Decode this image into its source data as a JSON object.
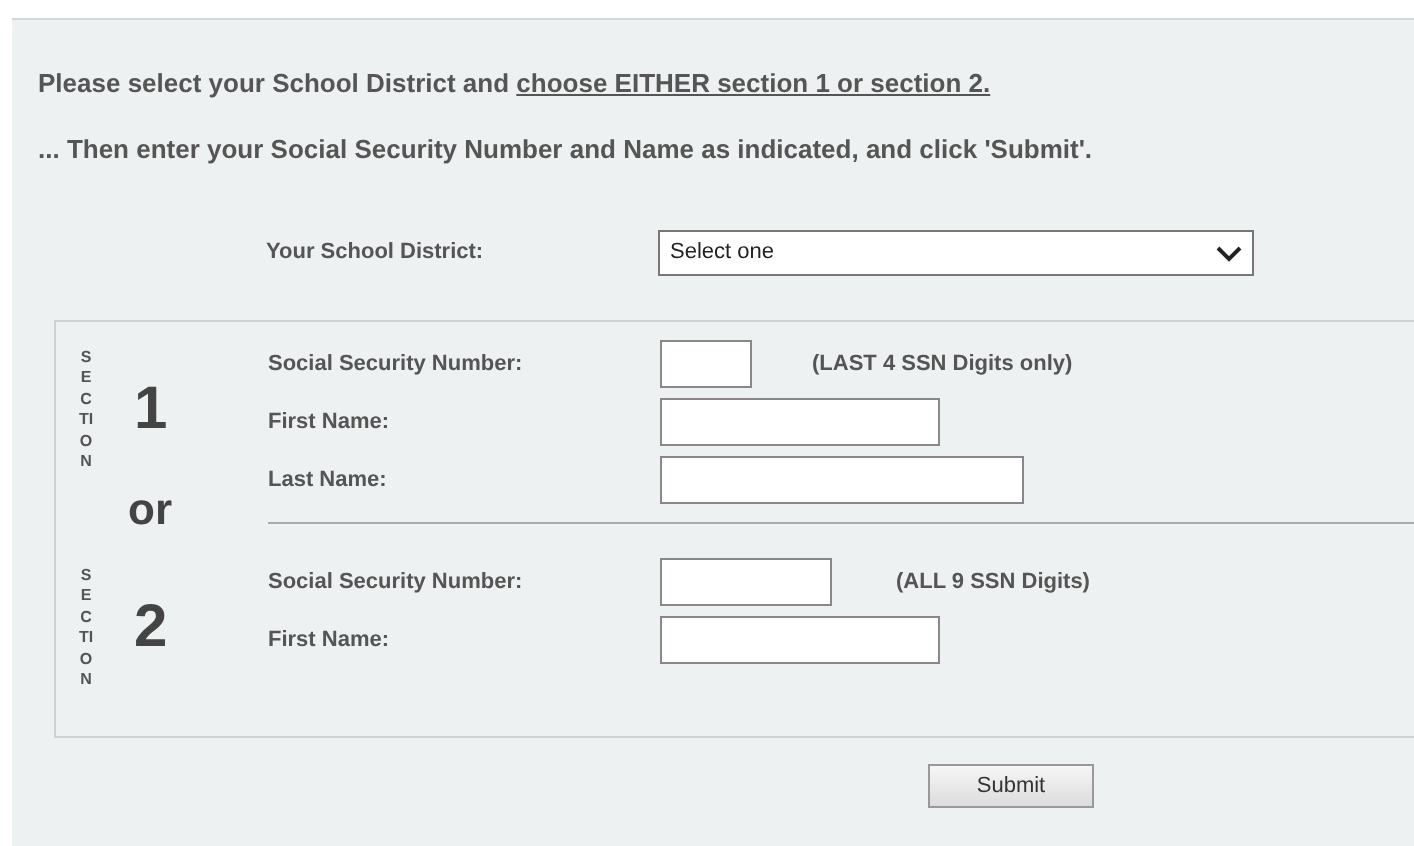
{
  "instructions": [
    {
      "text": "Please select your School District and",
      "underlined": "choose EITHER section 1 or section 2."
    },
    {
      "text": "... Then enter your Social Security Number and Name as indicated, and click 'Submit'."
    }
  ],
  "district": {
    "label": "Your School District:",
    "value": "Select one"
  },
  "sections": [
    {
      "word": "SECTION",
      "number": "1",
      "fields": [
        {
          "label": "Social Security Number:",
          "hint": "(LAST 4 SSN Digits only)"
        },
        {
          "label": "First Name:"
        },
        {
          "label": "Last Name:"
        }
      ]
    },
    {
      "word": "SECTION",
      "number": "2",
      "fields": [
        {
          "label": "Social Security Number:",
          "hint": "(ALL 9 SSN Digits)"
        },
        {
          "label": "First Name:"
        }
      ]
    }
  ],
  "separator": "or",
  "submit": "Submit"
}
